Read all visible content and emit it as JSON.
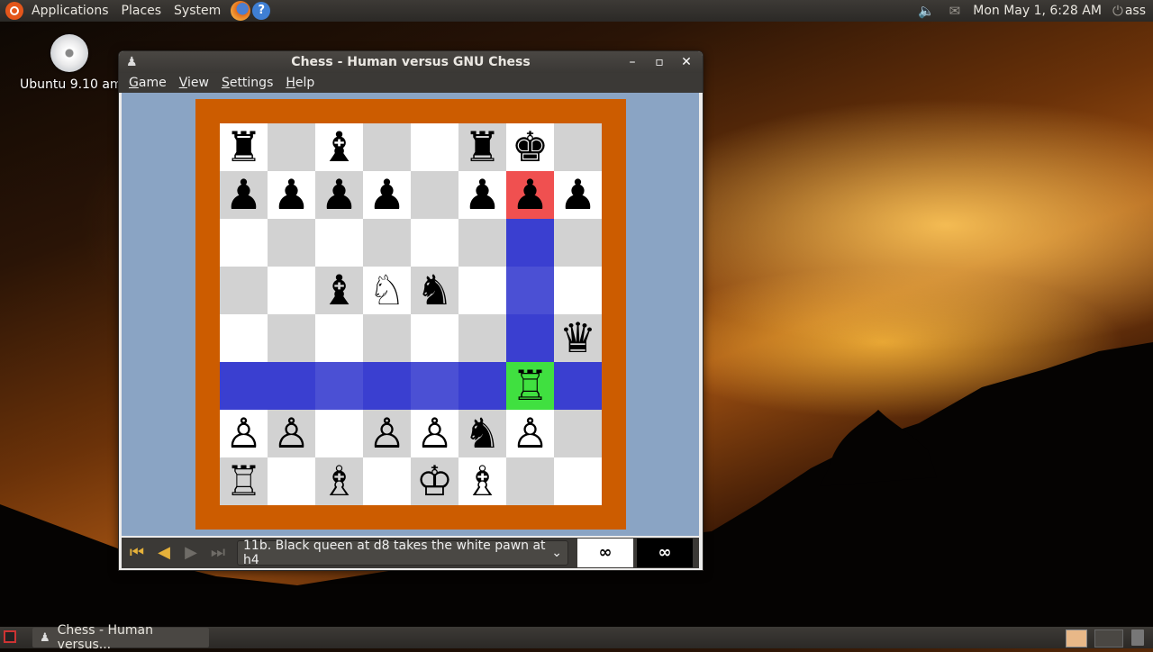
{
  "top_panel": {
    "menus": [
      "Applications",
      "Places",
      "System"
    ],
    "clock": "Mon May  1,  6:28 AM",
    "user": "ass"
  },
  "desktop": {
    "icon_label": "Ubuntu 9.10 am"
  },
  "window": {
    "title": "Chess - Human versus GNU Chess",
    "controls": {
      "minimize": "–",
      "maximize": "▫",
      "close": "✕"
    },
    "menu": [
      "Game",
      "View",
      "Settings",
      "Help"
    ]
  },
  "board": {
    "ranks": [
      [
        "♜",
        "",
        "♝",
        "",
        "",
        "♜",
        "♚",
        ""
      ],
      [
        "♟",
        "♟",
        "♟",
        "♟",
        "",
        "♟",
        "♟",
        "♟"
      ],
      [
        "",
        "",
        "",
        "",
        "",
        "",
        "",
        ""
      ],
      [
        "",
        "",
        "♝",
        "♘",
        "♞",
        "",
        "",
        ""
      ],
      [
        "",
        "",
        "",
        "",
        "",
        "",
        "",
        "♛"
      ],
      [
        "",
        "",
        "",
        "",
        "",
        "",
        "♖",
        ""
      ],
      [
        "♙",
        "♙",
        "",
        "♙",
        "♙",
        "♞",
        "♙",
        ""
      ],
      [
        "♖",
        "",
        "♗",
        "",
        "♔",
        "♗",
        "",
        ""
      ]
    ],
    "highlight_colors": {
      "move": "#3a3fd0",
      "check": "#f05050",
      "selected": "#40e040",
      "frame": "#cc5c00"
    }
  },
  "status": {
    "move_text": "11b. Black queen at d8 takes the white pawn at h4",
    "white_clock": "∞",
    "black_clock": "∞"
  },
  "taskbar": {
    "task_label": "Chess - Human versus..."
  }
}
